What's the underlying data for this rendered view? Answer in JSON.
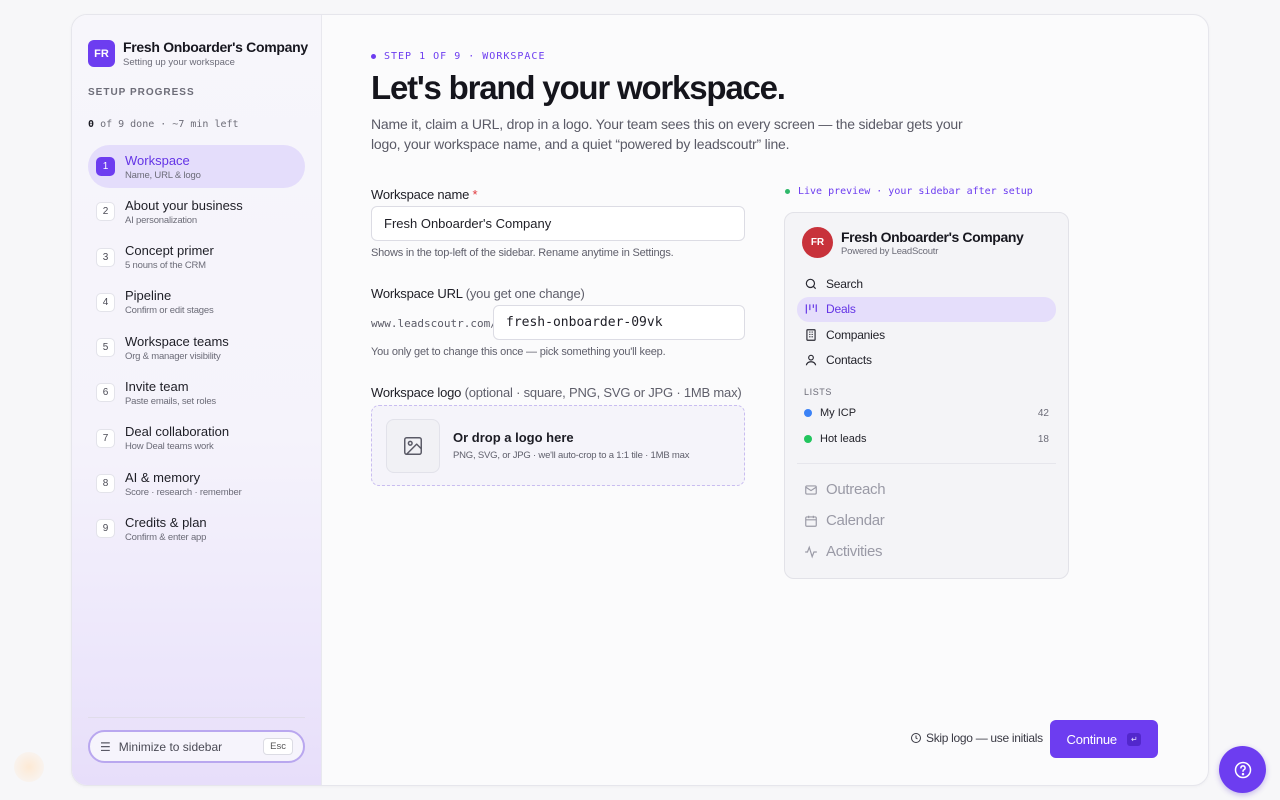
{
  "sidebar": {
    "brand_initials": "FR",
    "brand_name": "Fresh Onboarder's Company",
    "brand_sub": "Setting up your workspace",
    "progress_title": "SETUP PROGRESS",
    "progress_done": "0",
    "progress_rest": "of 9 done · ~7 min left",
    "steps": [
      {
        "num": "1",
        "label": "Workspace",
        "sub": "Name, URL & logo",
        "active": true
      },
      {
        "num": "2",
        "label": "About your business",
        "sub": "AI personalization"
      },
      {
        "num": "3",
        "label": "Concept primer",
        "sub": "5 nouns of the CRM"
      },
      {
        "num": "4",
        "label": "Pipeline",
        "sub": "Confirm or edit stages"
      },
      {
        "num": "5",
        "label": "Workspace teams",
        "sub": "Org & manager visibility"
      },
      {
        "num": "6",
        "label": "Invite team",
        "sub": "Paste emails, set roles"
      },
      {
        "num": "7",
        "label": "Deal collaboration",
        "sub": "How Deal teams work"
      },
      {
        "num": "8",
        "label": "AI & memory",
        "sub": "Score · research · remember"
      },
      {
        "num": "9",
        "label": "Credits & plan",
        "sub": "Confirm & enter app"
      }
    ],
    "minimize_label": "Minimize to sidebar",
    "minimize_key": "Esc"
  },
  "main": {
    "eyebrow": "STEP 1 OF 9 · WORKSPACE",
    "title": "Let's brand your workspace.",
    "lead": "Name it, claim a URL, drop in a logo. Your team sees this on every screen — the sidebar gets your logo, your workspace name, and a quiet “powered by leadscoutr” line.",
    "name_label": "Workspace name",
    "name_required": "*",
    "name_value": "Fresh Onboarder's Company",
    "name_hint": "Shows in the top-left of the sidebar. Rename anytime in Settings.",
    "url_label": "Workspace URL",
    "url_label_note": "(you get one change)",
    "url_prefix": "www.leadscoutr.com/",
    "url_value": "fresh-onboarder-09vk",
    "url_hint": "You only get to change this once — pick something you'll keep.",
    "logo_label": "Workspace logo",
    "logo_label_note": "(optional · square, PNG, SVG or JPG · 1MB max)",
    "drop_title": "Or drop a logo here",
    "drop_sub": "PNG, SVG, or JPG · we'll auto-crop to a 1:1 tile · 1MB max",
    "skip_label": "Skip logo — use initials",
    "continue_label": "Continue",
    "continue_key": "↵"
  },
  "preview": {
    "label": "Live preview · your sidebar after setup",
    "initials": "FR",
    "name": "Fresh Onboarder's Company",
    "sub": "Powered by LeadScoutr",
    "nav": [
      {
        "label": "Search",
        "icon": "search-icon"
      },
      {
        "label": "Deals",
        "icon": "deals-icon",
        "active": true
      },
      {
        "label": "Companies",
        "icon": "building-icon"
      },
      {
        "label": "Contacts",
        "icon": "person-icon"
      }
    ],
    "lists_heading": "LISTS",
    "lists": [
      {
        "label": "My ICP",
        "count": "42",
        "color": "#3b82f6"
      },
      {
        "label": "Hot leads",
        "count": "18",
        "color": "#22c55e"
      }
    ],
    "dim_nav": [
      {
        "label": "Outreach",
        "icon": "mail-icon"
      },
      {
        "label": "Calendar",
        "icon": "calendar-icon"
      },
      {
        "label": "Activities",
        "icon": "activity-icon"
      }
    ]
  },
  "colors": {
    "accent": "#6d3df0",
    "avatar": "#c8323b",
    "live_dot": "#2fb86a"
  }
}
